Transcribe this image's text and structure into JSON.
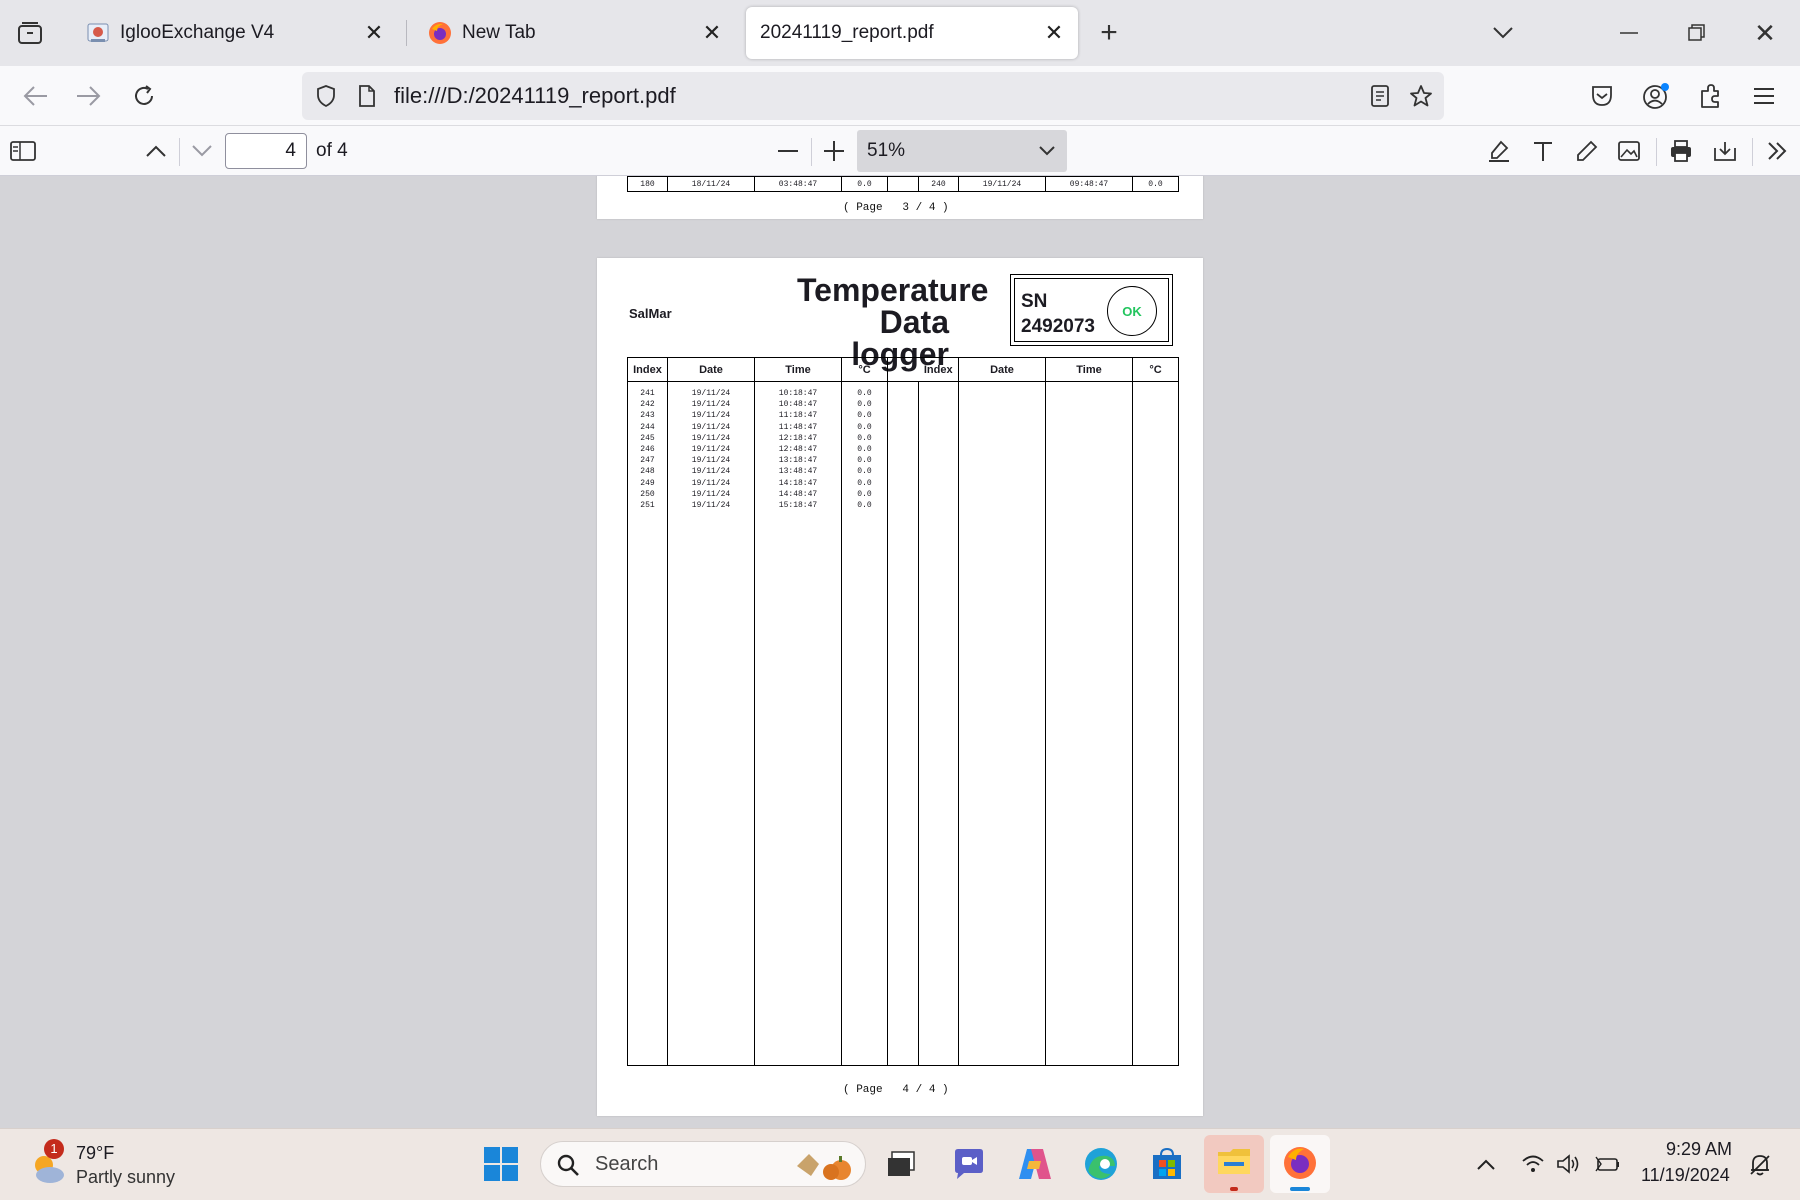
{
  "browser": {
    "tabs": [
      {
        "title": "IglooExchange V4",
        "active": false
      },
      {
        "title": "New Tab",
        "active": false
      },
      {
        "title": "20241119_report.pdf",
        "active": true
      }
    ],
    "url": "file:///D:/20241119_report.pdf"
  },
  "pdf_toolbar": {
    "page_number": "4",
    "page_of": "of 4",
    "zoom": "51%"
  },
  "document": {
    "prev_page": {
      "last_row_left": {
        "index": "180",
        "date": "18/11/24",
        "time": "03:48:47",
        "temp": "0.0"
      },
      "last_row_right": {
        "index": "240",
        "date": "19/11/24",
        "time": "09:48:47",
        "temp": "0.0"
      },
      "footer": "( Page   3 / 4 )"
    },
    "page": {
      "company": "SalMar",
      "title_line1": "Temperature",
      "title_line2": "Data logger",
      "sn_label": "SN",
      "sn_value": "2492073",
      "status": "OK",
      "status_color": "#22c55e",
      "headers": [
        "Index",
        "Date",
        "Time",
        "°C",
        "Index",
        "Date",
        "Time",
        "°C"
      ],
      "rows": [
        {
          "index": "241",
          "date": "19/11/24",
          "time": "10:18:47",
          "temp": "0.0"
        },
        {
          "index": "242",
          "date": "19/11/24",
          "time": "10:48:47",
          "temp": "0.0"
        },
        {
          "index": "243",
          "date": "19/11/24",
          "time": "11:18:47",
          "temp": "0.0"
        },
        {
          "index": "244",
          "date": "19/11/24",
          "time": "11:48:47",
          "temp": "0.0"
        },
        {
          "index": "245",
          "date": "19/11/24",
          "time": "12:18:47",
          "temp": "0.0"
        },
        {
          "index": "246",
          "date": "19/11/24",
          "time": "12:48:47",
          "temp": "0.0"
        },
        {
          "index": "247",
          "date": "19/11/24",
          "time": "13:18:47",
          "temp": "0.0"
        },
        {
          "index": "248",
          "date": "19/11/24",
          "time": "13:48:47",
          "temp": "0.0"
        },
        {
          "index": "249",
          "date": "19/11/24",
          "time": "14:18:47",
          "temp": "0.0"
        },
        {
          "index": "250",
          "date": "19/11/24",
          "time": "14:48:47",
          "temp": "0.0"
        },
        {
          "index": "251",
          "date": "19/11/24",
          "time": "15:18:47",
          "temp": "0.0"
        }
      ],
      "footer": "( Page   4 / 4 )"
    }
  },
  "taskbar": {
    "weather_temp": "79°F",
    "weather_desc": "Partly sunny",
    "weather_badge": "1",
    "search_placeholder": "Search",
    "time": "9:29 AM",
    "date": "11/19/2024"
  }
}
